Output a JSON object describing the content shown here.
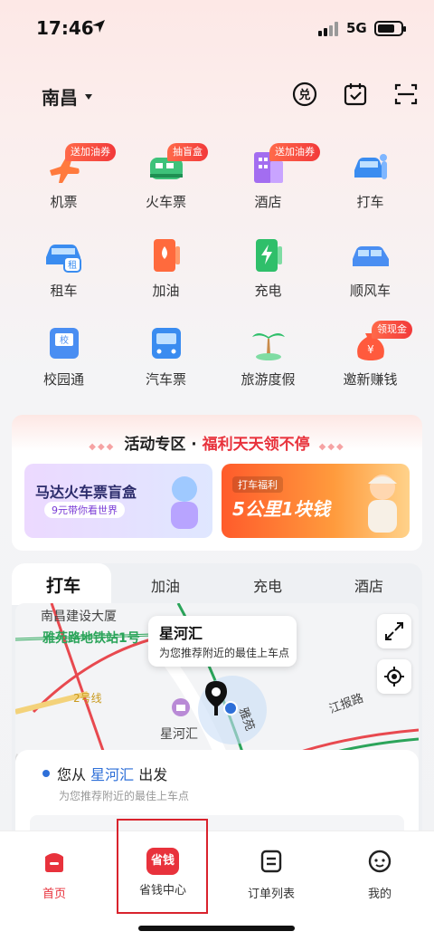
{
  "status_bar": {
    "time": "17:46",
    "network": "5G",
    "battery_level": 0.75
  },
  "header": {
    "city": "南昌",
    "icons": [
      "redeem-icon",
      "calendar-check-icon",
      "scan-icon"
    ]
  },
  "services": [
    {
      "label": "机票",
      "badge": "送加油券",
      "icon": "plane-icon",
      "color": "#ff7a3d"
    },
    {
      "label": "火车票",
      "badge": "抽盲盒",
      "icon": "train-icon",
      "color": "#3ec27a"
    },
    {
      "label": "酒店",
      "badge": "送加油券",
      "icon": "hotel-icon",
      "color": "#a36df0"
    },
    {
      "label": "打车",
      "badge": "",
      "icon": "taxi-icon",
      "color": "#3a8cf0"
    },
    {
      "label": "租车",
      "badge": "",
      "icon": "rent-car-icon",
      "color": "#3a8cf0"
    },
    {
      "label": "加油",
      "badge": "",
      "icon": "fuel-icon",
      "color": "#ff6a3d"
    },
    {
      "label": "充电",
      "badge": "",
      "icon": "charging-icon",
      "color": "#2fbf6a"
    },
    {
      "label": "顺风车",
      "badge": "",
      "icon": "carpool-icon",
      "color": "#4a8ef2"
    },
    {
      "label": "校园通",
      "badge": "",
      "icon": "school-bus-icon",
      "color": "#4a8ef2"
    },
    {
      "label": "汽车票",
      "badge": "",
      "icon": "bus-icon",
      "color": "#3a8cf0"
    },
    {
      "label": "旅游度假",
      "badge": "",
      "icon": "palm-tree-icon",
      "color": "#2fbf6a"
    },
    {
      "label": "邀新赚钱",
      "badge": "领现金",
      "icon": "money-bag-icon",
      "color": "#ff5a3d"
    }
  ],
  "activity": {
    "title_prefix": "活动专区 · ",
    "title_highlight": "福利天天领不停",
    "banner1": {
      "line1": "马达火车票盲盒",
      "line2": "9元带你看世界"
    },
    "banner2": {
      "line1": "打车福利",
      "line2": "5公里1块钱"
    }
  },
  "tabs": [
    "打车",
    "加油",
    "充电",
    "酒店"
  ],
  "map": {
    "labels": {
      "building": "南昌建设大厦",
      "metro": "雅苑路地铁站1号",
      "line2": "2号线",
      "poi": "星河汇",
      "road1": "雅苑",
      "road2": "江报路"
    },
    "popup": {
      "title": "星河汇",
      "subtitle": "为您推荐附近的最佳上车点"
    }
  },
  "ride": {
    "from_prefix": "您从 ",
    "from_place": "星河汇",
    "from_suffix": " 出发",
    "from_hint": "为您推荐附近的最佳上车点"
  },
  "bottom_nav": [
    {
      "label": "首页",
      "icon": "home-icon",
      "active": true
    },
    {
      "label": "省钱中心",
      "icon": "save-money-icon",
      "badge_text": "省钱",
      "active": false
    },
    {
      "label": "订单列表",
      "icon": "order-list-icon",
      "active": false
    },
    {
      "label": "我的",
      "icon": "profile-icon",
      "active": false
    }
  ]
}
